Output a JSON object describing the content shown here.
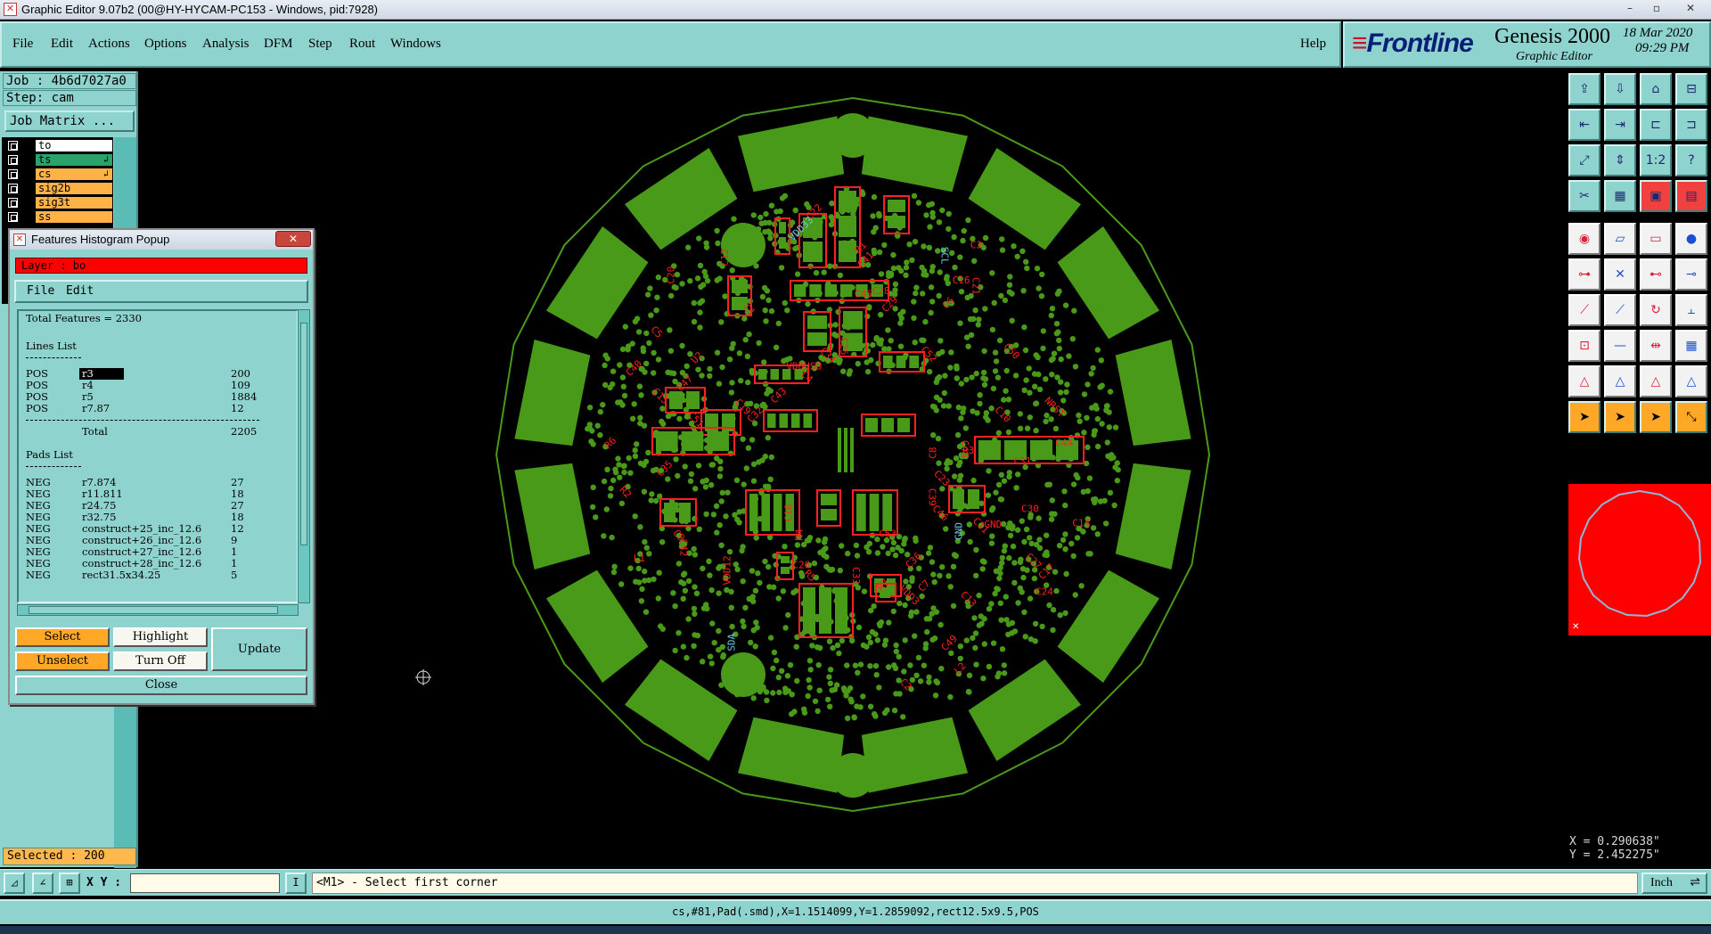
{
  "window": {
    "title": "Graphic Editor 9.07b2 (00@HY-HYCAM-PC153 - Windows, pid:7928)",
    "controls": [
      "–",
      "▫",
      "✕"
    ]
  },
  "menu": {
    "items": [
      "File",
      "Edit",
      "Actions",
      "Options",
      "Analysis",
      "DFM",
      "Step",
      "Rout",
      "Windows"
    ],
    "help": "Help"
  },
  "brand": {
    "logo": "Frontline",
    "product": "Genesis 2000",
    "subtitle": "Graphic Editor",
    "date": "18 Mar 2020",
    "time": "09:29 PM"
  },
  "left": {
    "job": "Job : 4b6d7027a0",
    "step": "Step: cam",
    "job_matrix": "Job Matrix ...",
    "layers": [
      {
        "name": "to",
        "color": "#ffffff",
        "mark": ""
      },
      {
        "name": "ts",
        "color": "#2aa36b",
        "mark": "↲"
      },
      {
        "name": "cs",
        "color": "#ffb347",
        "mark": "↲"
      },
      {
        "name": "sig2b",
        "color": "#ffb347",
        "mark": ""
      },
      {
        "name": "sig3t",
        "color": "#ffb347",
        "mark": ""
      },
      {
        "name": "ss",
        "color": "#ffb347",
        "mark": ""
      }
    ],
    "selected": "Selected : 200"
  },
  "popup": {
    "title": "Features Histogram Popup",
    "close_x": "✕",
    "layer": "Layer :  bo",
    "menu": [
      "File",
      "Edit"
    ],
    "total": "Total Features = 2330",
    "lines_title": "Lines List",
    "lines": [
      {
        "pol": "POS",
        "sym": "r3",
        "count": "200",
        "highlight": true
      },
      {
        "pol": "POS",
        "sym": "r4",
        "count": "109"
      },
      {
        "pol": "POS",
        "sym": "r5",
        "count": "1884"
      },
      {
        "pol": "POS",
        "sym": "r7.87",
        "count": "12"
      }
    ],
    "lines_total_label": "Total",
    "lines_total": "2205",
    "pads_title": "Pads List",
    "pads": [
      {
        "pol": "NEG",
        "sym": "r7.874",
        "count": "27"
      },
      {
        "pol": "NEG",
        "sym": "r11.811",
        "count": "18"
      },
      {
        "pol": "NEG",
        "sym": "r24.75",
        "count": "27"
      },
      {
        "pol": "NEG",
        "sym": "r32.75",
        "count": "18"
      },
      {
        "pol": "NEG",
        "sym": "construct+25_inc_12.6",
        "count": "12"
      },
      {
        "pol": "NEG",
        "sym": "construct+26_inc_12.6",
        "count": "9"
      },
      {
        "pol": "NEG",
        "sym": "construct+27_inc_12.6",
        "count": "1"
      },
      {
        "pol": "NEG",
        "sym": "construct+28_inc_12.6",
        "count": "1"
      },
      {
        "pol": "NEG",
        "sym": "rect31.5x34.25",
        "count": "5"
      }
    ],
    "buttons": {
      "select": "Select",
      "highlight": "Highlight",
      "unselect": "Unselect",
      "turn_off": "Turn Off",
      "update": "Update",
      "close": "Close"
    }
  },
  "board": {
    "labels": [
      "GND",
      "VDD3",
      "C48",
      "C52",
      "C53",
      "R2",
      "C11",
      "C9",
      "C10",
      "C14",
      "C13",
      "C12",
      "R3",
      "C5",
      "C6",
      "C7",
      "C8",
      "R1",
      "C3",
      "C4",
      "C1",
      "C2",
      "C29",
      "C28",
      "U2",
      "VDDUSB",
      "VDD12",
      "C36",
      "C35",
      "C34",
      "C33",
      "C32",
      "C31",
      "C30",
      "C17",
      "C15",
      "C16",
      "C18",
      "C19",
      "C21",
      "C20",
      "R5",
      "R4",
      "C24",
      "C23",
      "C40",
      "C39",
      "C44",
      "C45",
      "C41",
      "C42",
      "L2",
      "L1",
      "C43",
      "C27",
      "C26",
      "C25",
      "C22",
      "VDD33",
      "GND",
      "SDA",
      "SCL",
      "NRST",
      "C49",
      "C50",
      "C51",
      "R6",
      "R7",
      "C46",
      "C47"
    ]
  },
  "toolbar": {
    "icons": [
      "open-icon",
      "save-icon",
      "home-icon",
      "layout-icon",
      "undo-step-icon",
      "redo-step-icon",
      "fit-icon",
      "stretch-icon",
      "zoom-fit-icon",
      "zoom-window-icon",
      "ratio-icon",
      "query-icon",
      "snap-icon",
      "grid-icon",
      "layers-panel-icon",
      "layers-list-icon",
      "camera-icon",
      "draw-icon",
      "ruler-icon",
      "pad-icon",
      "net-icon",
      "move-node-icon",
      "connect-icon",
      "route-icon",
      "line-add-icon",
      "line-edit-icon",
      "arc-icon",
      "split-icon",
      "polygon-icon",
      "trim-icon",
      "measure-icon",
      "array-icon",
      "triangle-icon",
      "triangle-add-icon",
      "shape-icon",
      "shape-edit-icon",
      "pointer-icon",
      "select-icon",
      "select-area-icon",
      "select-net-icon"
    ],
    "ratio_label": "1:2"
  },
  "coords": {
    "x": "X = 0.290638\"",
    "y": "Y = 2.452275\""
  },
  "cmd": {
    "xy_label": "X Y :",
    "xy_value": "",
    "prompt": "<M1> - Select first corner",
    "unit": "Inch",
    "unit_arrow": "⇌"
  },
  "status": "cs,#81,Pad(.smd),X=1.1514099,Y=1.2859092,rect12.5x9.5,POS"
}
